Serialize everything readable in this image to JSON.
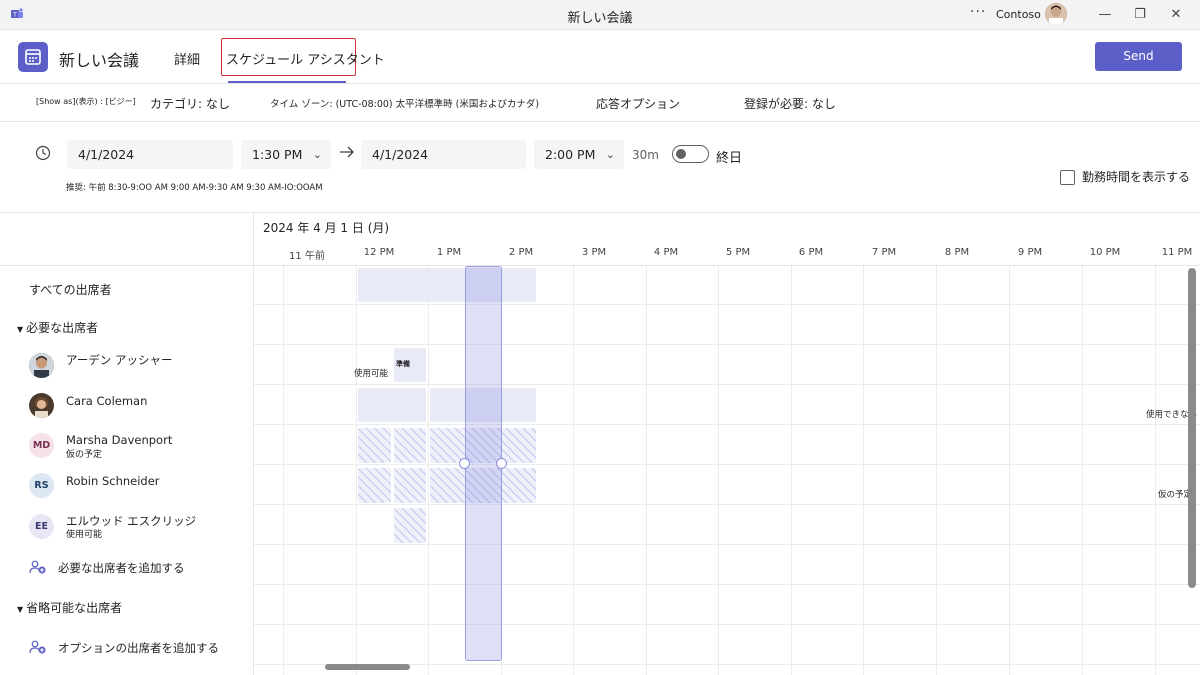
{
  "window": {
    "title": "新しい会議",
    "more": "···",
    "org": "Contoso",
    "minimize": "—",
    "restore": "❐",
    "close": "✕"
  },
  "header": {
    "title": "新しい会議",
    "tabs": [
      "詳細",
      "スケジュール アシスタント"
    ],
    "send_label": "Send"
  },
  "options": {
    "show_as_prefix": "[Show as](表示) : [ビジー]",
    "category": "カテゴリ: なし",
    "timezone": "タイム ゾーン: (UTC-08:00) 太平洋標準時 (米国およびカナダ)",
    "response": "応答オプション",
    "registration": "登録が必要: なし"
  },
  "datetime": {
    "start_date": "4/1/2024",
    "start_time": "1:30 PM",
    "end_date": "4/1/2024",
    "end_time": "2:00 PM",
    "duration": "30m",
    "allday_label": "終日",
    "suggestion": "推奨: 午前 8:30-9:OO AM 9:00 AM-9:30 AM 9:30 AM-IO:OOAM",
    "show_work_hours": "勤務時間を表示する"
  },
  "schedule": {
    "date_heading": "2024 年 4 月 1 日 (月)",
    "hours": [
      "11 午前",
      "12 PM",
      "1 PM",
      "2 PM",
      "3 PM",
      "4 PM",
      "5 PM",
      "6 PM",
      "7 PM",
      "8 PM",
      "9 PM",
      "10 PM",
      "11 PM"
    ],
    "all_attendees": "すべての出席者",
    "required_group": "必要な出席者",
    "optional_group": "省略可能な出席者",
    "add_required": "必要な出席者を追加する",
    "add_optional": "オプションの出席者を追加する",
    "attendees": [
      {
        "name": "アーデン アッシャー",
        "status": "",
        "initials": "",
        "avatar_color": "#3b3b3b"
      },
      {
        "name": "Cara Coleman",
        "status": "",
        "initials": "",
        "avatar_color": "#5a4636"
      },
      {
        "name": "Marsha Davenport",
        "status": "仮の予定",
        "initials": "MD",
        "avatar_color": "#f4e1ea"
      },
      {
        "name": "Robin Schneider",
        "status": "",
        "initials": "RS",
        "avatar_color": "#dde6f3"
      },
      {
        "name": "エルウッド エスクリッジ",
        "status": "使用可能",
        "initials": "EE",
        "avatar_color": "#e8e6f5"
      }
    ],
    "grid_labels": {
      "available": "使用可能",
      "block_label": "準備",
      "unavailable": "使用できない",
      "tentative": "仮の予定"
    }
  },
  "colors": {
    "accent": "#5b5fc7",
    "highlight_border": "#d13438",
    "busy": "#e8eaf8",
    "tentative_stripe": "#c5c8ee"
  }
}
